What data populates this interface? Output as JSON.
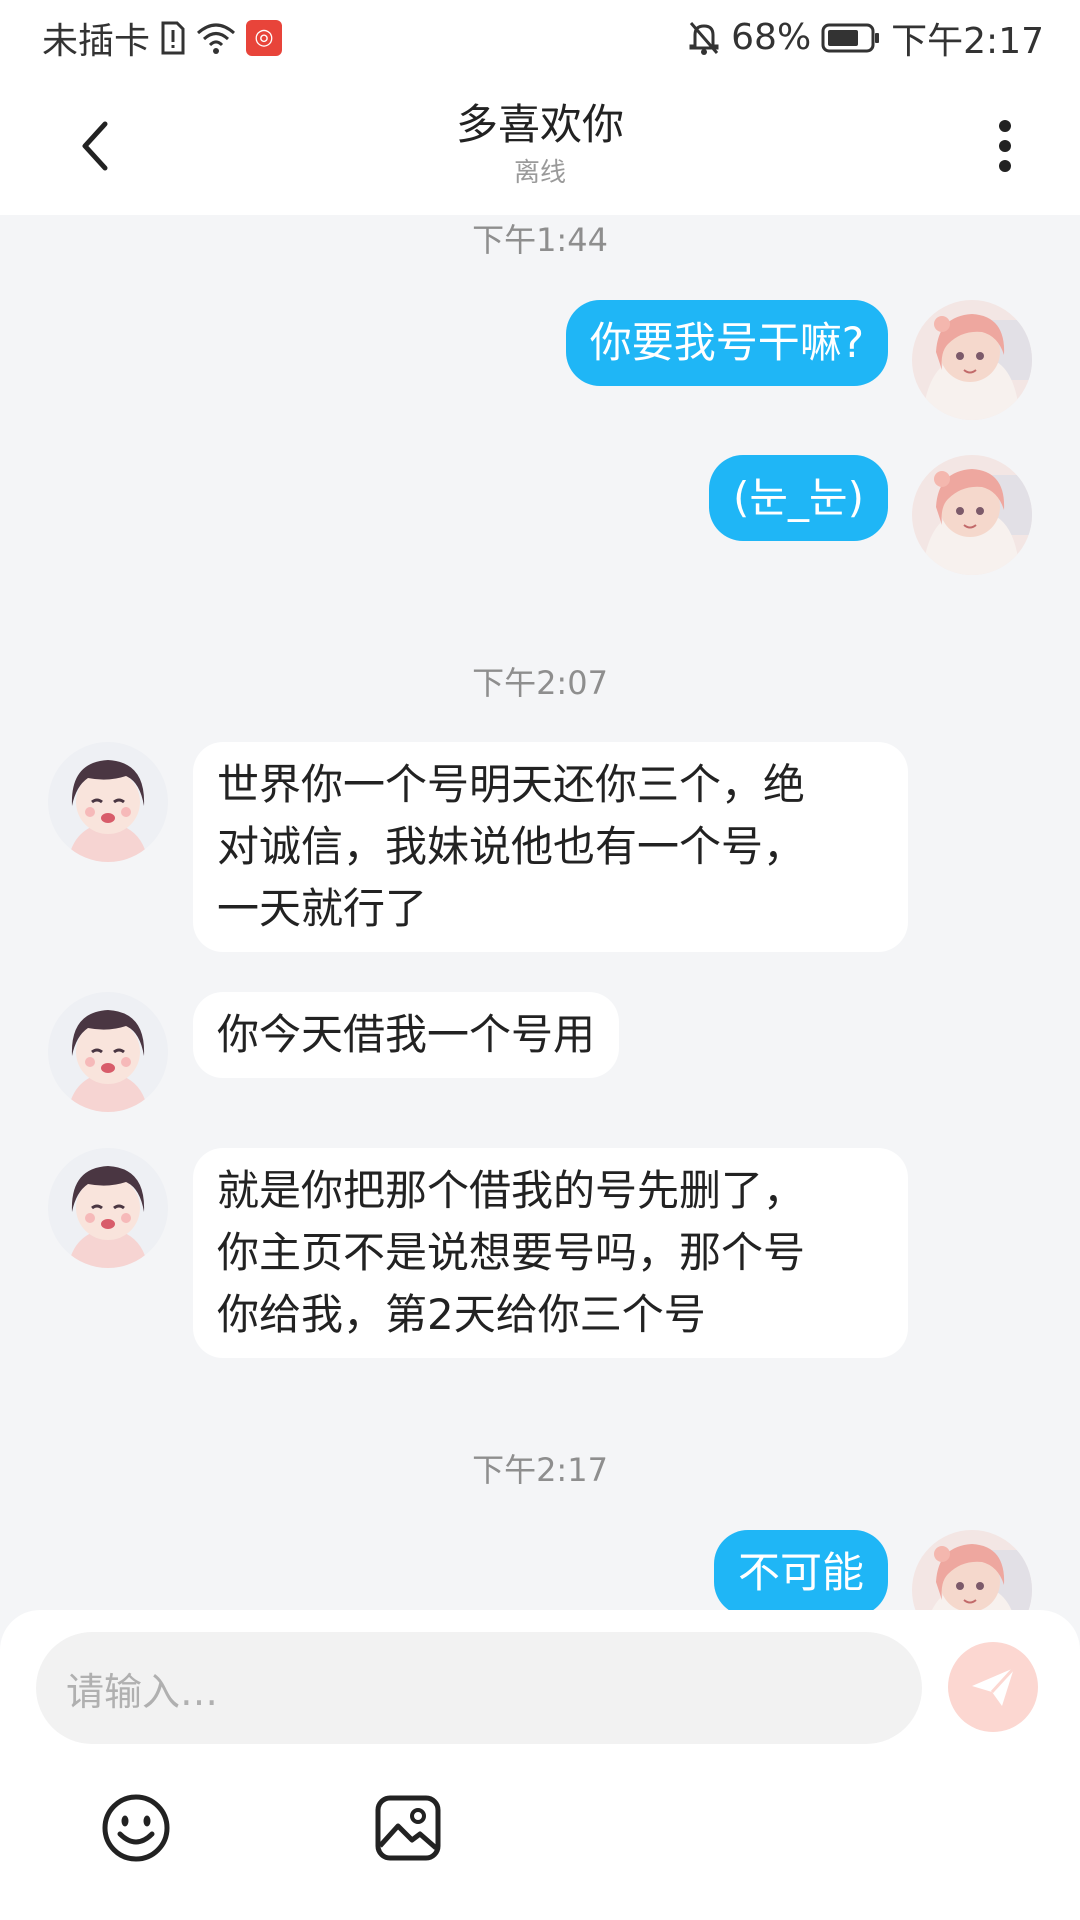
{
  "status_bar": {
    "carrier": "未插卡",
    "battery": "68%",
    "time": "下午2:17"
  },
  "header": {
    "title": "多喜欢你",
    "subtitle": "离线"
  },
  "messages": {
    "ts1": "下午1:44",
    "m1": "你要我号干嘛?",
    "m2": "(눈_눈)",
    "ts2": "下午2:07",
    "m3_l1": "世界你一个号明天还你三个，绝",
    "m3_l2": "对诚信，我妹说他也有一个号，",
    "m3_l3": "一天就行了",
    "m4": "你今天借我一个号用",
    "m5_l1": "就是你把那个借我的号先删了，",
    "m5_l2": "你主页不是说想要号吗，那个号",
    "m5_l3": "你给我，第2天给你三个号",
    "ts3": "下午2:17",
    "m6": "不可能"
  },
  "composer": {
    "placeholder": "请输入…"
  },
  "colors": {
    "outgoing_bubble": "#1fb6f6",
    "incoming_bubble": "#ffffff",
    "send_button": "#fcd7d1",
    "background": "#f4f5f7"
  },
  "icons": {
    "back": "chevron-left-icon",
    "more": "more-vertical-icon",
    "send": "paper-plane-icon",
    "emoji": "smiley-icon",
    "image": "image-icon"
  }
}
